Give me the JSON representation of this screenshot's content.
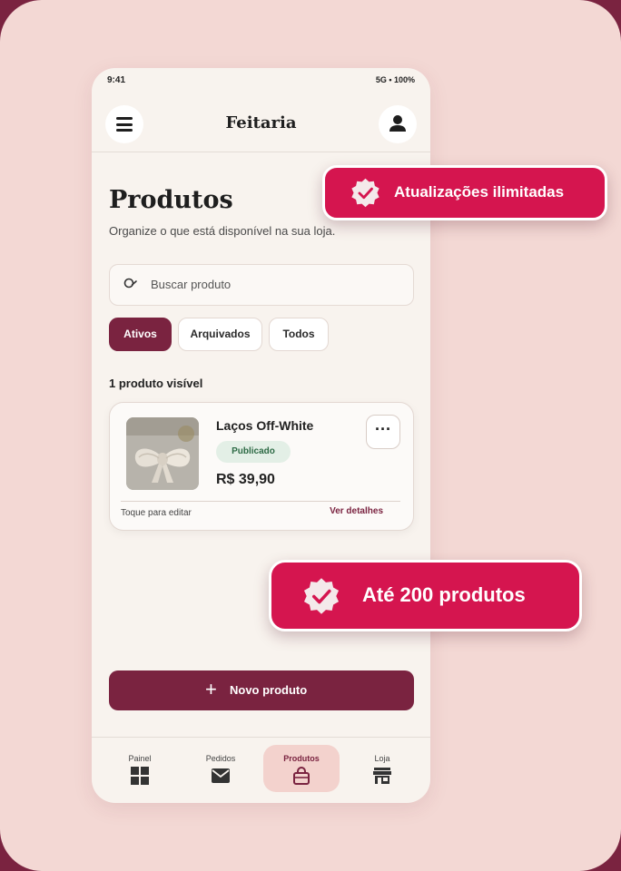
{
  "status_bar": {
    "time": "9:41",
    "network": "5G • 100%"
  },
  "header": {
    "brand": "Feitaria"
  },
  "page": {
    "title": "Produtos",
    "subtitle": "Organize o que está disponível na sua loja."
  },
  "search": {
    "placeholder": "Buscar produto",
    "value": ""
  },
  "filters": [
    {
      "label": "Ativos",
      "active": true
    },
    {
      "label": "Arquivados",
      "active": false
    },
    {
      "label": "Todos",
      "active": false
    }
  ],
  "count_label": "1 produto visível",
  "product": {
    "name": "Laços Off-White",
    "status": "Publicado",
    "price": "R$ 39,90",
    "hint": "Toque para editar",
    "details_link": "Ver detalhes",
    "more_label": "···"
  },
  "new_button": {
    "icon": "+",
    "label": "Novo produto"
  },
  "bottom_nav": [
    {
      "label": "Painel",
      "icon": "grid-icon",
      "active": false
    },
    {
      "label": "Pedidos",
      "icon": "envelope-icon",
      "active": false
    },
    {
      "label": "Produtos",
      "icon": "shopping-bag-icon",
      "active": true
    },
    {
      "label": "Loja",
      "icon": "store-icon",
      "active": false
    }
  ],
  "callouts": [
    {
      "text": "Atualizações ilimitadas",
      "icon": "verified-check-icon"
    },
    {
      "text": "Até 200 produtos",
      "icon": "verified-check-icon"
    }
  ],
  "colors": {
    "brand": "#7a2340",
    "accent": "#d5154f",
    "background": "#f3d8d4",
    "success_text": "#2d6a45"
  }
}
